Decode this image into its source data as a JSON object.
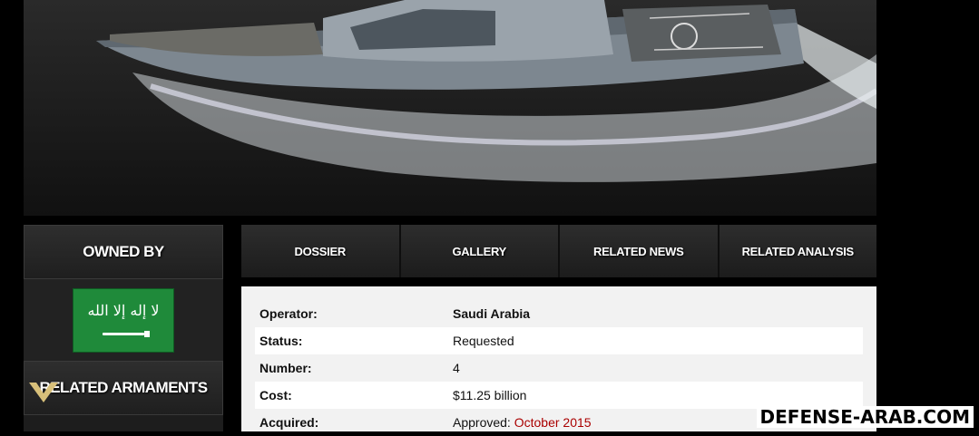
{
  "sidebar": {
    "owned_by_title": "OWNED BY",
    "flag_country": "Saudi Arabia",
    "related_armaments_title": "RELATED ARMAMENTS"
  },
  "tabs": [
    {
      "label": "DOSSIER"
    },
    {
      "label": "GALLERY"
    },
    {
      "label": "RELATED NEWS"
    },
    {
      "label": "RELATED ANALYSIS"
    }
  ],
  "details": {
    "operator": {
      "label": "Operator:",
      "value": "Saudi Arabia"
    },
    "status": {
      "label": "Status:",
      "value": "Requested"
    },
    "number": {
      "label": "Number:",
      "value": "4"
    },
    "cost": {
      "label": "Cost:",
      "value": "$11.25 billion"
    },
    "acquired": {
      "label": "Acquired:",
      "value_prefix": "Approved: ",
      "value_date": "October 2015"
    }
  },
  "watermark": "DEFENSE-ARAB.COM",
  "colors": {
    "flag_green": "#1f8a3a",
    "date_red": "#aa0000"
  }
}
